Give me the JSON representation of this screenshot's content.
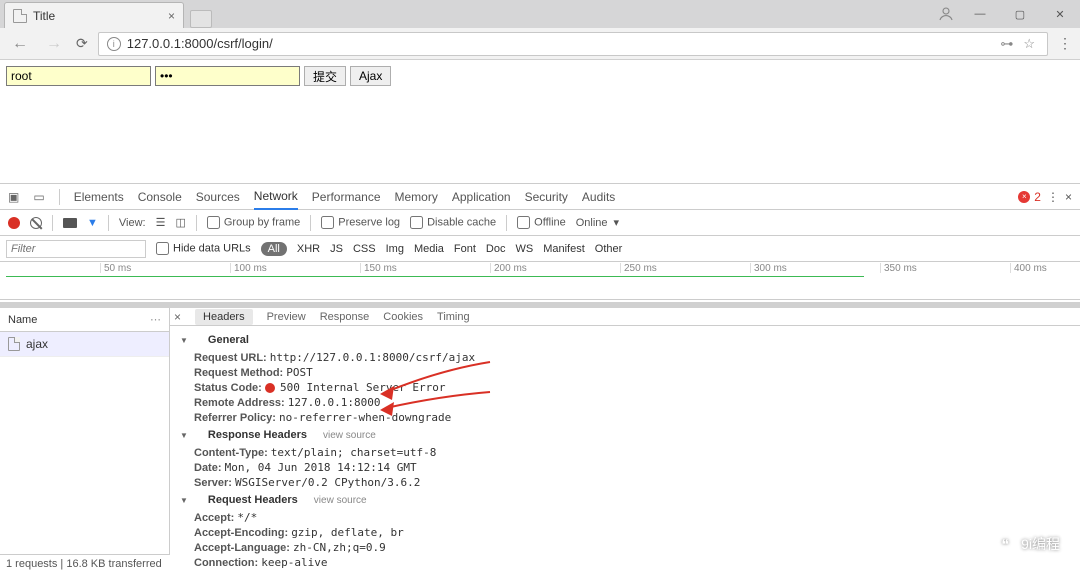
{
  "browser": {
    "tab_title": "Title",
    "url": "127.0.0.1:8000/csrf/login/"
  },
  "page": {
    "username": "root",
    "password": "•••",
    "submit": "提交",
    "ajax": "Ajax"
  },
  "devtools": {
    "tabs": [
      "Elements",
      "Console",
      "Sources",
      "Network",
      "Performance",
      "Memory",
      "Application",
      "Security",
      "Audits"
    ],
    "active_tab": "Network",
    "error_count": "2",
    "toolbar": {
      "view_label": "View:",
      "group_by_frame": "Group by frame",
      "preserve_log": "Preserve log",
      "disable_cache": "Disable cache",
      "offline": "Offline",
      "online": "Online"
    },
    "filter": {
      "placeholder": "Filter",
      "hide_urls": "Hide data URLs",
      "all": "All",
      "types": [
        "XHR",
        "JS",
        "CSS",
        "Img",
        "Media",
        "Font",
        "Doc",
        "WS",
        "Manifest",
        "Other"
      ]
    },
    "overview_ticks": [
      "50 ms",
      "100 ms",
      "150 ms",
      "200 ms",
      "250 ms",
      "300 ms",
      "350 ms",
      "400 ms"
    ],
    "reqlist": {
      "header": "Name",
      "item": "ajax"
    },
    "detail_tabs": [
      "Headers",
      "Preview",
      "Response",
      "Cookies",
      "Timing"
    ],
    "headers": {
      "general": "General",
      "url_l": "Request URL:",
      "url_v": "http://127.0.0.1:8000/csrf/ajax",
      "method_l": "Request Method:",
      "method_v": "POST",
      "status_l": "Status Code:",
      "status_v": "500 Internal Server Error",
      "remote_l": "Remote Address:",
      "remote_v": "127.0.0.1:8000",
      "ref_l": "Referrer Policy:",
      "ref_v": "no-referrer-when-downgrade",
      "resp_hdr": "Response Headers",
      "view_source": "view source",
      "ct_l": "Content-Type:",
      "ct_v": "text/plain; charset=utf-8",
      "date_l": "Date:",
      "date_v": "Mon, 04 Jun 2018 14:12:14 GMT",
      "srv_l": "Server:",
      "srv_v": "WSGIServer/0.2 CPython/3.6.2",
      "req_hdr": "Request Headers",
      "acc_l": "Accept:",
      "acc_v": "*/*",
      "ae_l": "Accept-Encoding:",
      "ae_v": "gzip, deflate, br",
      "al_l": "Accept-Language:",
      "al_v": "zh-CN,zh;q=0.9",
      "conn_l": "Connection:",
      "conn_v": "keep-alive"
    },
    "footer": "1 requests | 16.8 KB transferred"
  },
  "watermark": "9i编程"
}
